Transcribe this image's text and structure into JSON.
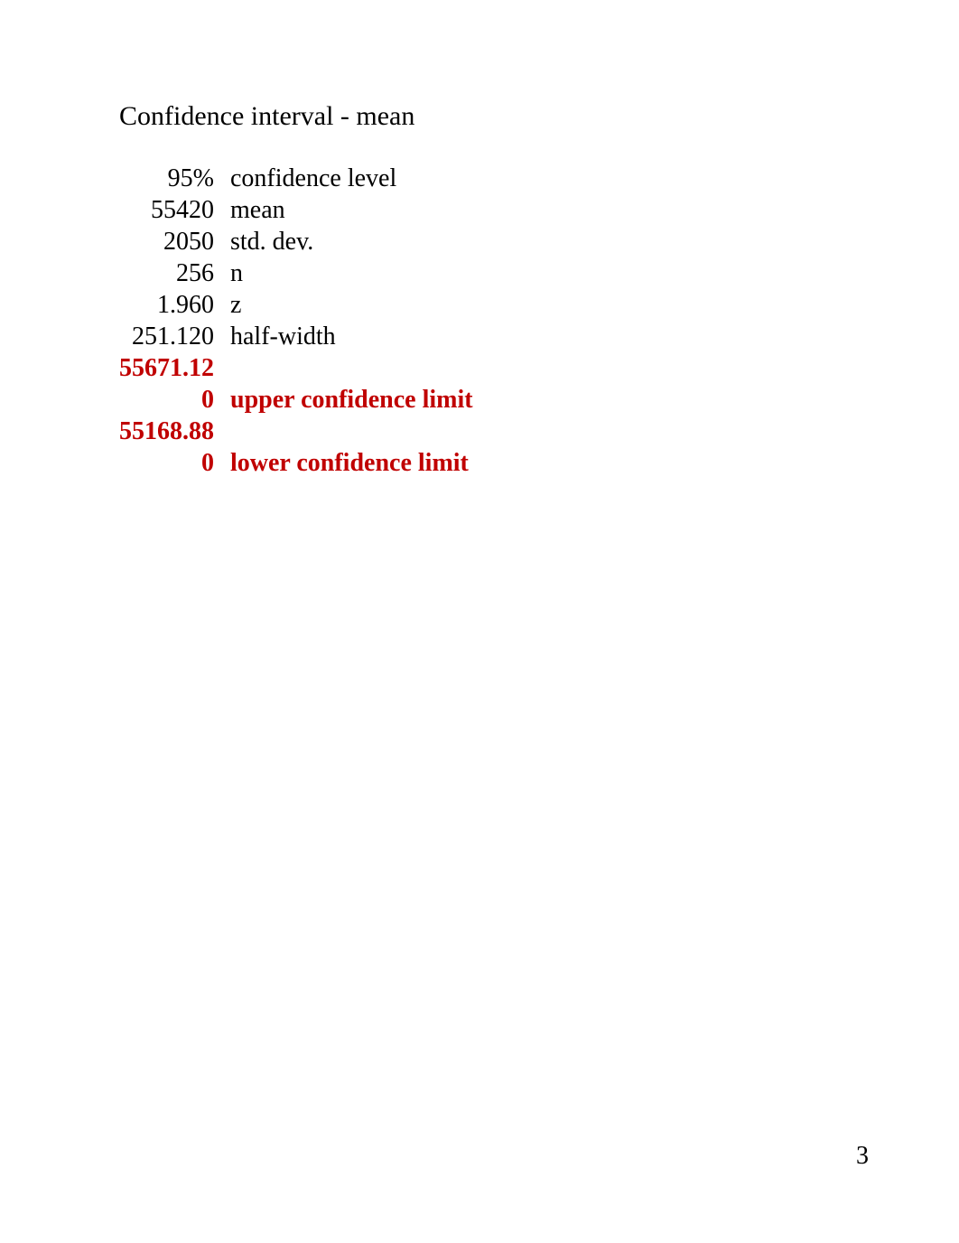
{
  "title": "Confidence interval - mean",
  "rows": [
    {
      "value": "95%",
      "label": "confidence level",
      "highlight": false
    },
    {
      "value": "55420",
      "label": "mean",
      "highlight": false
    },
    {
      "value": "2050",
      "label": "std. dev.",
      "highlight": false
    },
    {
      "value": "256",
      "label": "n",
      "highlight": false
    },
    {
      "value": "1.960",
      "label": "z",
      "highlight": false
    },
    {
      "value": "251.120",
      "label": "half-width",
      "highlight": false
    },
    {
      "value": "55671.12",
      "label": "",
      "highlight": true
    },
    {
      "value": "0",
      "label": "upper confidence limit",
      "highlight": true
    },
    {
      "value": "55168.88",
      "label": "",
      "highlight": true
    },
    {
      "value": "0",
      "label": "lower confidence limit",
      "highlight": true
    }
  ],
  "page_number": "3"
}
